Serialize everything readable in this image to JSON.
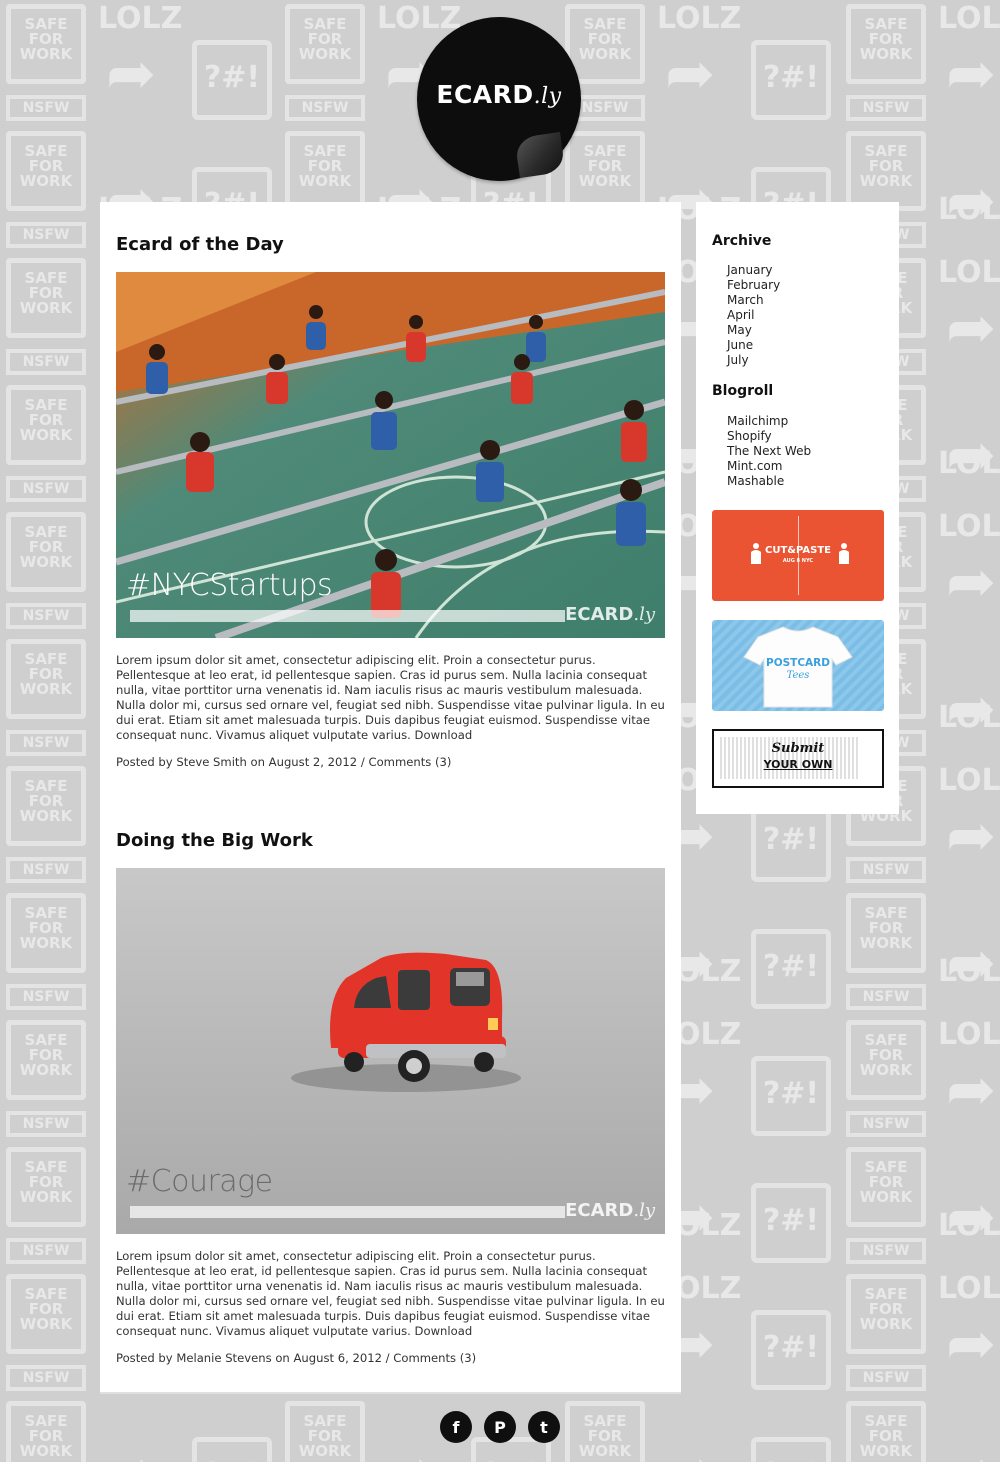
{
  "site": {
    "logo_text": "ECARD",
    "logo_suffix": ".ly"
  },
  "background": {
    "safe_text": "SAFE FOR WORK",
    "nsfw_text": "NSFW",
    "lolz_text": "LOLZ",
    "symbol_text": "?#!"
  },
  "posts": [
    {
      "title": "Ecard of the Day",
      "image_hashtag": "#NYCStartups",
      "image_watermark": "ECARD",
      "image_watermark_suffix": ".ly",
      "body": "Lorem ipsum dolor sit amet, consectetur adipiscing elit. Proin a consectetur purus. Pellentesque at leo erat, id pellentesque sapien. Cras id purus sem. Nulla lacinia consequat nulla, vitae porttitor urna venenatis id. Nam iaculis risus ac mauris vestibulum malesuada. Nulla dolor mi, cursus sed ornare vel, feugiat sed nibh. Suspendisse vitae pulvinar ligula. In eu dui erat. Etiam sit amet malesuada turpis. Duis dapibus feugiat euismod. Suspendisse vitae consequat nunc. Vivamus aliquet vulputate varius.",
      "download_label": "Download",
      "posted_by_prefix": "Posted by",
      "author": "Steve Smith",
      "date_prefix": "on",
      "date": "August 2, 2012",
      "separator": "/",
      "comments": "Comments (3)"
    },
    {
      "title": "Doing the Big Work",
      "image_hashtag": "#Courage",
      "image_watermark": "ECARD",
      "image_watermark_suffix": ".ly",
      "body": "Lorem ipsum dolor sit amet, consectetur adipiscing elit. Proin a consectetur purus. Pellentesque at leo erat, id pellentesque sapien. Cras id purus sem. Nulla lacinia consequat nulla, vitae porttitor urna venenatis id. Nam iaculis risus ac mauris vestibulum malesuada. Nulla dolor mi, cursus sed ornare vel, feugiat sed nibh. Suspendisse vitae pulvinar ligula. In eu dui erat. Etiam sit amet malesuada turpis. Duis dapibus feugiat euismod. Suspendisse vitae consequat nunc. Vivamus aliquet vulputate varius.",
      "download_label": "Download",
      "posted_by_prefix": "Posted by",
      "author": "Melanie Stevens",
      "date_prefix": "on",
      "date": "August 6, 2012",
      "separator": "/",
      "comments": "Comments (3)"
    }
  ],
  "sidebar": {
    "archive_heading": "Archive",
    "archive": [
      "January",
      "February",
      "March",
      "April",
      "May",
      "June",
      "July"
    ],
    "blogroll_heading": "Blogroll",
    "blogroll": [
      "Mailchimp",
      "Shopify",
      "The Next Web",
      "Mint.com",
      "Mashable"
    ],
    "promo_cutpaste": {
      "label": "CUT&PASTE",
      "sub": "AUG 8 NYC",
      "color": "#ea5432"
    },
    "promo_tees": {
      "label": "POSTCARD",
      "sub": "Tees",
      "color": "#8cc8ec"
    },
    "promo_submit": {
      "line1": "Submit",
      "line2": "YOUR OWN"
    }
  },
  "social": [
    {
      "name": "facebook-icon",
      "glyph": "f"
    },
    {
      "name": "pinterest-icon",
      "glyph": "P"
    },
    {
      "name": "twitter-icon",
      "glyph": "t"
    }
  ]
}
